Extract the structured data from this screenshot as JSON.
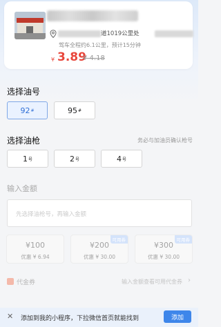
{
  "station": {
    "address_text": "道1019公里处",
    "drive_info": "驾车全程约6.1公里，预计15分钟",
    "price_symbol": "¥",
    "price": "3.89",
    "old_price": "¥ 4.18"
  },
  "oil_no": {
    "title": "选择油号",
    "options": [
      {
        "label": "92",
        "suffix": "#",
        "selected": true
      },
      {
        "label": "95",
        "suffix": "#",
        "selected": false
      }
    ]
  },
  "gun": {
    "title": "选择油枪",
    "note": "务必与加油员确认枪号",
    "options": [
      {
        "label": "1",
        "suffix": "号"
      },
      {
        "label": "2",
        "suffix": "号"
      },
      {
        "label": "4",
        "suffix": "号"
      }
    ]
  },
  "amount": {
    "title": "输入金额",
    "placeholder": "先选择油枪号，再输入金额"
  },
  "presets": [
    {
      "value": "¥100",
      "discount": "优惠 ¥ 6.94",
      "tag": ""
    },
    {
      "value": "¥200",
      "discount": "优惠 ¥ 30.00",
      "tag": "可用券"
    },
    {
      "value": "¥300",
      "discount": "优惠 ¥ 30.00",
      "tag": "可用券"
    }
  ],
  "coupon": {
    "label": "代金券",
    "hint": "输入金额查看可用代金券",
    "chevron": "›"
  },
  "banner": {
    "close": "✕",
    "text": "添加到我的小程序，下拉微信首页就能找到",
    "button": "添加"
  },
  "colors": {
    "accent": "#3e86ea",
    "price": "#e8463b",
    "selected_border": "#7fa7e6"
  }
}
